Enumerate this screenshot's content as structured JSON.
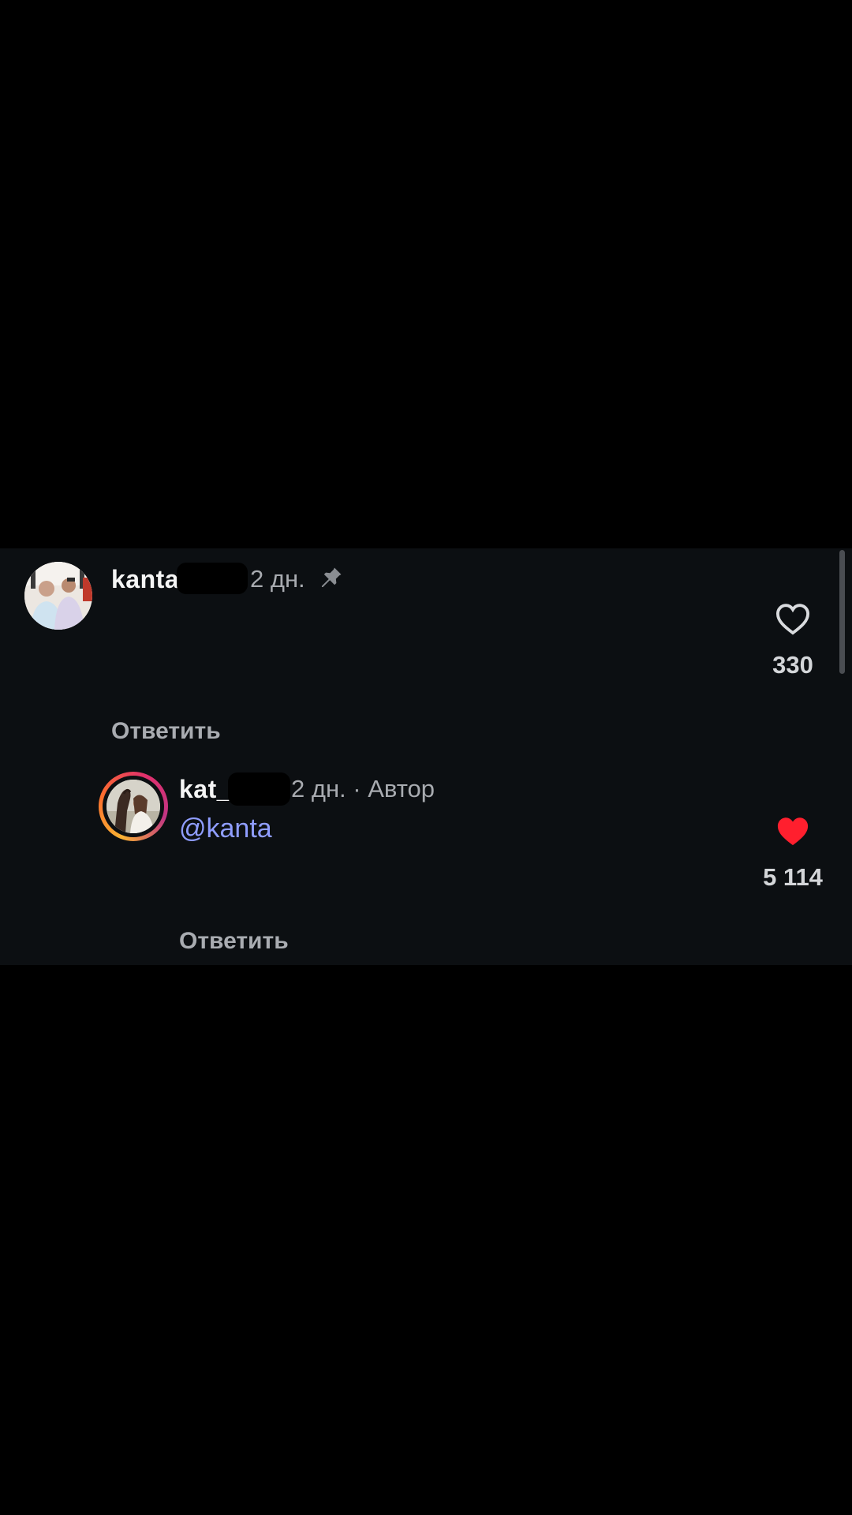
{
  "comments": [
    {
      "username": "kanta",
      "time": "2 дн.",
      "pinned": true,
      "likes": "330",
      "liked": false,
      "reply_label": "Ответить"
    },
    {
      "username": "kat_",
      "time": "2 дн. · Автор",
      "mention": "@kanta",
      "likes": "5 114",
      "liked": true,
      "reply_label": "Ответить"
    }
  ],
  "icons": {
    "pin": "pin-icon",
    "like_outline": "heart-outline-icon",
    "like_filled": "heart-filled-icon"
  },
  "colors": {
    "panel_background": "#0c0f12",
    "liked_heart": "#ff1f2e",
    "mention": "#8f9dff"
  }
}
